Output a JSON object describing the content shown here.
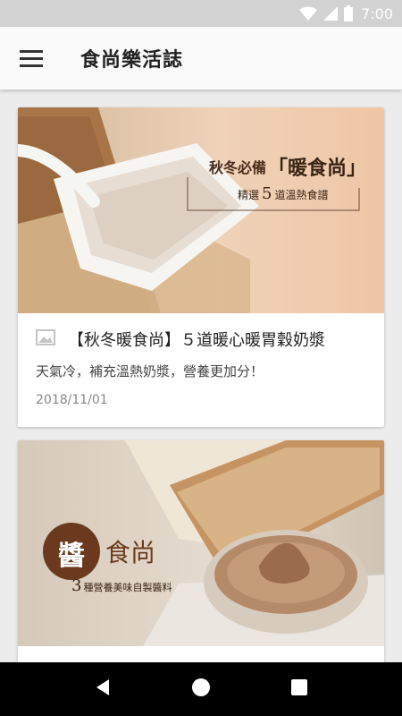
{
  "status_bar": {
    "time": "7:00",
    "icons": [
      "wifi-icon",
      "cell-signal-icon",
      "battery-icon"
    ]
  },
  "app_bar": {
    "title": "食尚樂活誌",
    "menu_icon": "hamburger-menu-icon"
  },
  "articles": [
    {
      "image_text": {
        "line1": "秋冬必備",
        "line2": "「暖食尚」",
        "line3": "精選",
        "num": "5",
        "line4": "道溫熱食譜"
      },
      "title": "【秋冬暖食尚】５道暖心暖胃穀奶漿",
      "subtitle": "天氣冷，補充溫熱奶漿，營養更加分！",
      "date": "2018/11/01"
    },
    {
      "image_text": {
        "seal": "醬",
        "word": "食尚",
        "num": "3",
        "caption": "種營養美味自製醬料"
      }
    }
  ],
  "nav_bar": {
    "icons": [
      "back-icon",
      "home-icon",
      "recents-icon"
    ]
  },
  "colors": {
    "status_bar": "#d2d2d2",
    "app_bar": "#fafafa",
    "background": "#ececec",
    "nav_bar": "#000000",
    "brand_brown": "#6b3a1e"
  }
}
